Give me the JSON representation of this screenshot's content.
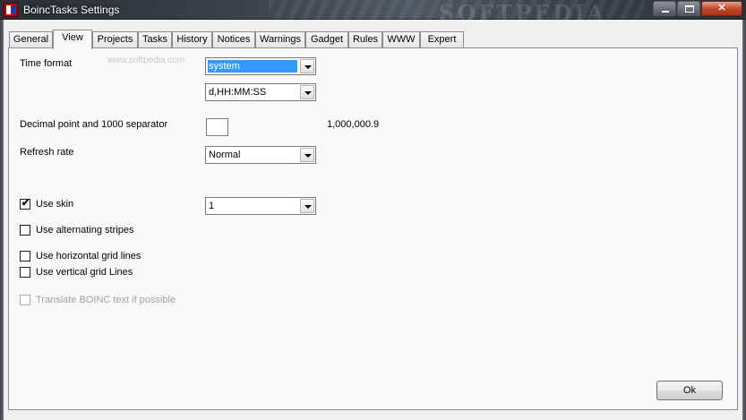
{
  "window": {
    "title": "BoincTasks Settings",
    "watermark": "SOFTPEDIA",
    "close_glyph": "✕"
  },
  "tabs": [
    {
      "label": "General"
    },
    {
      "label": "View",
      "active": true
    },
    {
      "label": "Projects"
    },
    {
      "label": "Tasks"
    },
    {
      "label": "History"
    },
    {
      "label": "Notices"
    },
    {
      "label": "Warnings"
    },
    {
      "label": "Gadget"
    },
    {
      "label": "Rules"
    },
    {
      "label": "WWW"
    },
    {
      "label": "Expert"
    }
  ],
  "view": {
    "time_format_label": "Time format",
    "time_format_value": "system",
    "time_format_pattern": "d,HH:MM:SS",
    "decimal_label": "Decimal point and 1000 separator",
    "decimal_example": "1,000,000.9",
    "refresh_label": "Refresh rate",
    "refresh_value": "Normal",
    "use_skin_label": "Use skin",
    "use_skin_checked": true,
    "skin_value": "1",
    "alternating_label": "Use alternating stripes",
    "horizontal_label": "Use horizontal grid lines",
    "vertical_label": "Use vertical grid Lines",
    "translate_label": "Translate BOINC text if possible",
    "check_glyph": "✔",
    "softpedia_text": "www.softpedia.com"
  },
  "footer": {
    "ok_label": "Ok"
  }
}
